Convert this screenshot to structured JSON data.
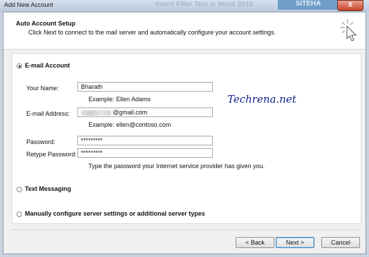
{
  "window": {
    "title": "Add New Account",
    "background_text": "Insert Filler Text in Word 2010",
    "background_badge": "SITEHA",
    "close_glyph": "X"
  },
  "header": {
    "title": "Auto Account Setup",
    "subtitle": "Click Next to connect to the mail server and automatically configure your account settings.",
    "icon": "wand-sparkle-icon"
  },
  "options": {
    "email_account": {
      "label": "E-mail Account",
      "selected": true
    },
    "text_messaging": {
      "label": "Text Messaging",
      "selected": false
    },
    "manual": {
      "label": "Manually configure server settings or additional server types",
      "selected": false
    }
  },
  "form": {
    "your_name": {
      "label": "Your Name:",
      "value": "Bharath",
      "example": "Example: Ellen Adams"
    },
    "email": {
      "label": "E-mail Address:",
      "value": "@gmail.com",
      "example": "Example: ellen@contoso.com"
    },
    "password": {
      "label": "Password:",
      "value": "*********"
    },
    "retype_password": {
      "label": "Retype Password:",
      "value": "*********"
    },
    "password_hint": "Type the password your Internet service provider has given you."
  },
  "watermark": "Techrena.net",
  "buttons": {
    "back": "< Back",
    "next": "Next >",
    "cancel": "Cancel"
  }
}
